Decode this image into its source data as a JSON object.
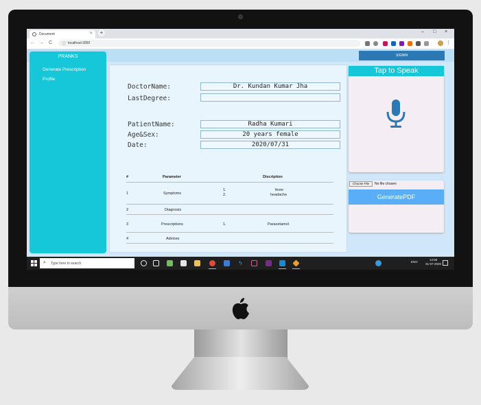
{
  "browser": {
    "tab_title": "Document",
    "tab_close": "×",
    "new_tab": "+",
    "url": "localhost:3000",
    "window_minimize": "–",
    "window_maximize": "□",
    "window_close": "×",
    "back": "←",
    "forward": "→",
    "reload": "C"
  },
  "app": {
    "brand": "PRANKS",
    "signin_label": "SIGNIN",
    "sidebar": {
      "items": [
        {
          "label": "Generate Prescription"
        },
        {
          "label": "Profile"
        }
      ]
    },
    "form": {
      "doctor_name_label": "DoctorName:",
      "doctor_name_value": "Dr. Kundan Kumar Jha",
      "last_degree_label": "LastDegree:",
      "last_degree_value": "",
      "patient_name_label": "PatientName:",
      "patient_name_value": "Radha Kumari",
      "age_sex_label": "Age&Sex:",
      "age_sex_value": "20 years female",
      "date_label": "Date:",
      "date_value": "2020/07/31"
    },
    "table": {
      "headers": [
        "#",
        "Parameter",
        "Discription"
      ],
      "rows": [
        {
          "num": "1",
          "parameter": "Symptoms",
          "items": [
            {
              "idx": "1.",
              "desc": "fever"
            },
            {
              "idx": "2.",
              "desc": "headache"
            }
          ]
        },
        {
          "num": "2",
          "parameter": "Diagnosis",
          "items": []
        },
        {
          "num": "3",
          "parameter": "Prescriptions",
          "items": [
            {
              "idx": "1.",
              "desc": "Paracetamol"
            }
          ]
        },
        {
          "num": "4",
          "parameter": "Advices",
          "items": []
        }
      ]
    },
    "speak_label": "Tap to Speak",
    "choose_file_label": "Choose File",
    "file_status": "No file chosen",
    "generate_pdf_label": "GeneratePDF"
  },
  "taskbar": {
    "search_placeholder": "Type here to search",
    "tray_lang": "ENG",
    "time": "13:06",
    "date": "31-07-2020"
  },
  "colors": {
    "sidebar": "#16c7d9",
    "signin": "#2a79b5",
    "speak_button": "#16c7d9",
    "generate_pdf": "#5aaef5",
    "mic": "#2a79b5"
  }
}
